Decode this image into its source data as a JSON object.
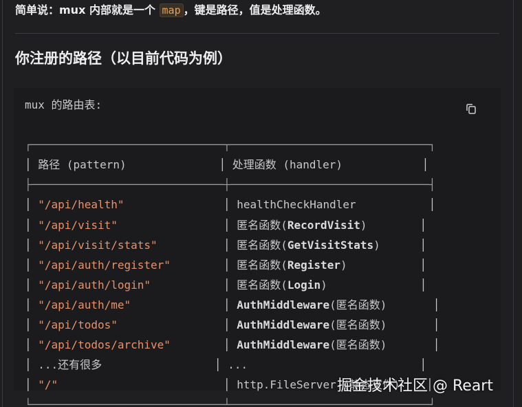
{
  "intro": {
    "prefix": "简单说：mux 内部就是一个 ",
    "code": "map",
    "suffix": "，键是路径，值是处理函数。"
  },
  "heading": "你注册的路径（以目前代码为例）",
  "code_block": {
    "lines": [
      {
        "segments": [
          {
            "t": "mux 的路由表:",
            "c": "plain"
          }
        ]
      },
      {
        "segments": [
          {
            "t": "",
            "c": "plain"
          }
        ]
      },
      {
        "segments": [
          {
            "t": "┌─────────────────────────────┬──────────────────────────────┐",
            "c": "box"
          }
        ]
      },
      {
        "segments": [
          {
            "t": "│ 路径 (pattern)              │ 处理函数 (handler)            │",
            "c": "plain"
          }
        ]
      },
      {
        "segments": [
          {
            "t": "├─────────────────────────────┼──────────────────────────────┤",
            "c": "box"
          }
        ]
      },
      {
        "segments": [
          {
            "t": "│ ",
            "c": "plain"
          },
          {
            "t": "\"/api/health\"",
            "c": "str"
          },
          {
            "t": "               │ healthCheckHandler           │",
            "c": "plain"
          }
        ]
      },
      {
        "segments": [
          {
            "t": "│ ",
            "c": "plain"
          },
          {
            "t": "\"/api/visit\"",
            "c": "str"
          },
          {
            "t": "                │ 匿名函数(",
            "c": "plain"
          },
          {
            "t": "RecordVisit",
            "c": "bold"
          },
          {
            "t": ")        │",
            "c": "plain"
          }
        ]
      },
      {
        "segments": [
          {
            "t": "│ ",
            "c": "plain"
          },
          {
            "t": "\"/api/visit/stats\"",
            "c": "str"
          },
          {
            "t": "          │ 匿名函数(",
            "c": "plain"
          },
          {
            "t": "GetVisitStats",
            "c": "bold"
          },
          {
            "t": ")      │",
            "c": "plain"
          }
        ]
      },
      {
        "segments": [
          {
            "t": "│ ",
            "c": "plain"
          },
          {
            "t": "\"/api/auth/register\"",
            "c": "str"
          },
          {
            "t": "        │ 匿名函数(",
            "c": "plain"
          },
          {
            "t": "Register",
            "c": "bold"
          },
          {
            "t": ")           │",
            "c": "plain"
          }
        ]
      },
      {
        "segments": [
          {
            "t": "│ ",
            "c": "plain"
          },
          {
            "t": "\"/api/auth/login\"",
            "c": "str"
          },
          {
            "t": "           │ 匿名函数(",
            "c": "plain"
          },
          {
            "t": "Login",
            "c": "bold"
          },
          {
            "t": ")              │",
            "c": "plain"
          }
        ]
      },
      {
        "segments": [
          {
            "t": "│ ",
            "c": "plain"
          },
          {
            "t": "\"/api/auth/me\"",
            "c": "str"
          },
          {
            "t": "              │ ",
            "c": "plain"
          },
          {
            "t": "AuthMiddleware",
            "c": "bold"
          },
          {
            "t": "(匿名函数)       │",
            "c": "plain"
          }
        ]
      },
      {
        "segments": [
          {
            "t": "│ ",
            "c": "plain"
          },
          {
            "t": "\"/api/todos\"",
            "c": "str"
          },
          {
            "t": "                │ ",
            "c": "plain"
          },
          {
            "t": "AuthMiddleware",
            "c": "bold"
          },
          {
            "t": "(匿名函数)       │",
            "c": "plain"
          }
        ]
      },
      {
        "segments": [
          {
            "t": "│ ",
            "c": "plain"
          },
          {
            "t": "\"/api/todos/archive\"",
            "c": "str"
          },
          {
            "t": "        │ ",
            "c": "plain"
          },
          {
            "t": "AuthMiddleware",
            "c": "bold"
          },
          {
            "t": "(匿名函数)       │",
            "c": "plain"
          }
        ]
      },
      {
        "segments": [
          {
            "t": "│ ...还有很多                 │ ...                          │",
            "c": "plain"
          }
        ]
      },
      {
        "segments": [
          {
            "t": "│ ",
            "c": "plain"
          },
          {
            "t": "\"/\"",
            "c": "str"
          },
          {
            "t": "                         │ http.FileServer (静态文件)    │",
            "c": "plain"
          }
        ]
      },
      {
        "segments": [
          {
            "t": "└─────────────────────────────┴──────────────────────────────┘",
            "c": "box"
          }
        ]
      }
    ]
  },
  "copy_icon": "copy-icon",
  "watermark": "掘金技术社区 @ Reart",
  "colors": {
    "background": "#1f1f22",
    "code_background": "#1b1b1e",
    "string": "#e8926a",
    "inline_code": "#e8a05a"
  }
}
